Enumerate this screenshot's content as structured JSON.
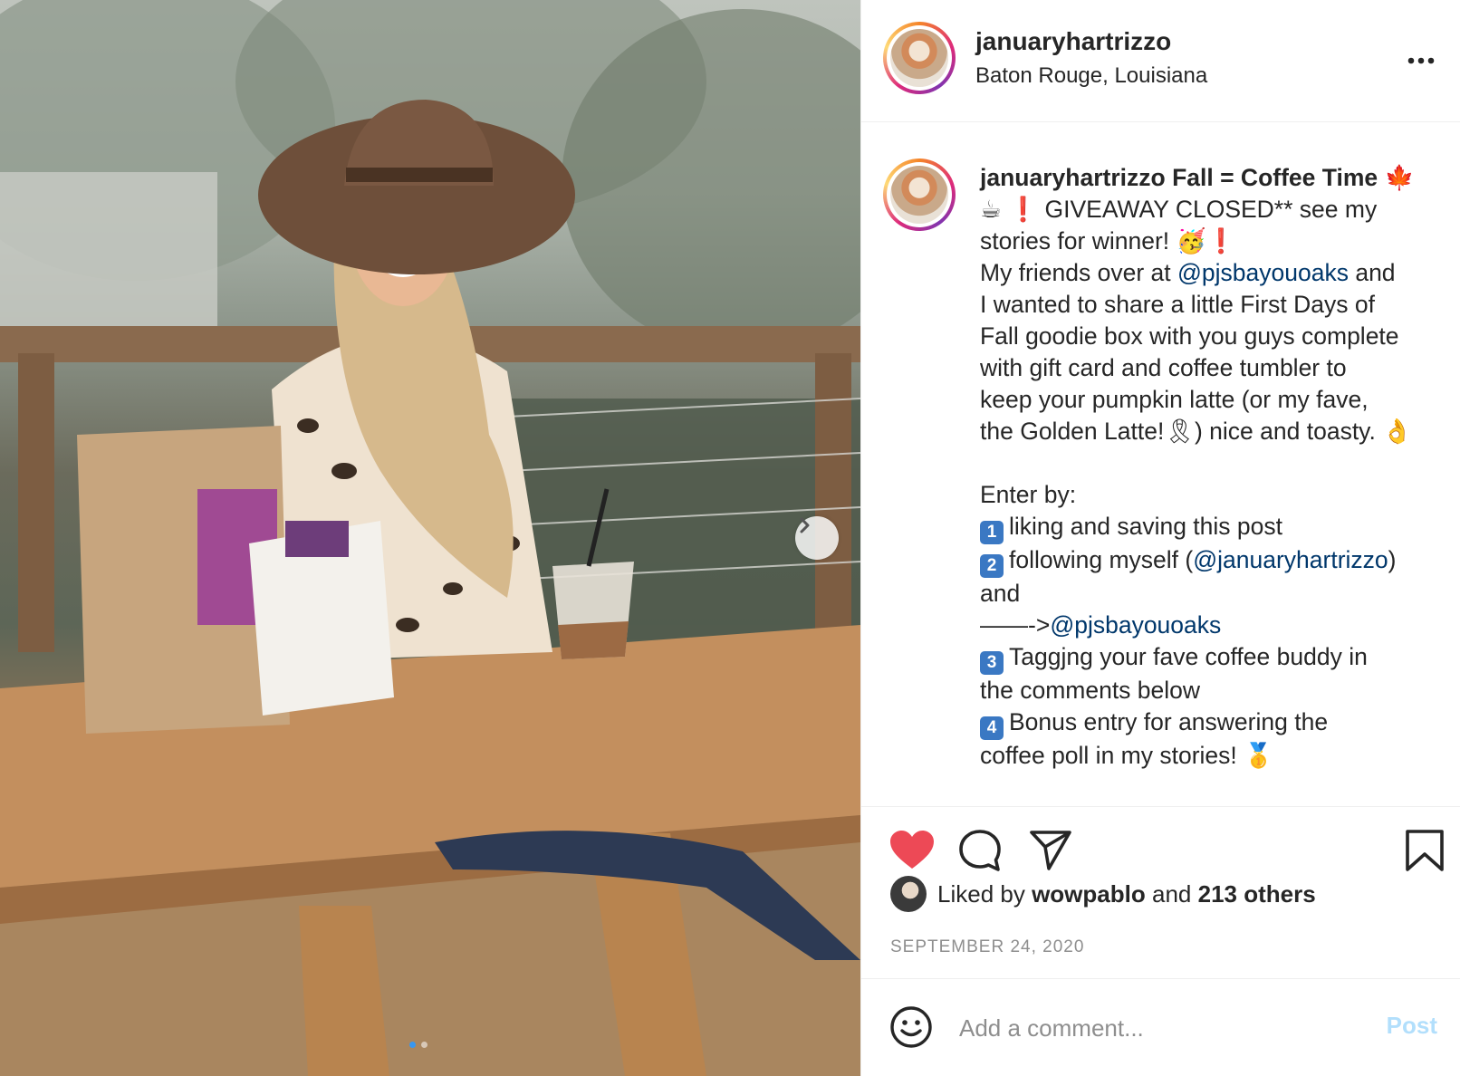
{
  "post": {
    "username": "januaryhartrizzo",
    "location": "Baton Rouge, Louisiana",
    "more_label": "•••"
  },
  "caption": {
    "username": "januaryhartrizzo",
    "title_text": "Fall = Coffee Time",
    "leaf_emoji": "🍁",
    "coffee_emoji": "☕",
    "exclaim": "❗",
    "giveaway_text": "GIVEAWAY CLOSED** see my",
    "stories_text": "stories for winner!",
    "party_emoji": "🥳",
    "l4_a": "My friends over at",
    "mention_pjs": "@pjsbayouoaks",
    "l4_b": "and",
    "l5": "I wanted to share a little First Days of",
    "l6": "Fall goodie box with you guys complete",
    "l7": "with gift card and coffee tumbler to",
    "l8": "keep your pumpkin latte (or my fave,",
    "l9_a": "the Golden Latte!",
    "ribbon_emoji": "🎗",
    "l9_b": ") nice and toasty.",
    "ok_emoji": "👌",
    "enter_by": "Enter by:",
    "step1_num": "1",
    "step1": "liking and saving this post",
    "step2_num": "2",
    "step2_a": "following myself (",
    "mention_self": "@januaryhartrizzo",
    "step2_b": ")",
    "and_text": "and",
    "arrow_text": "——->",
    "mention_pjs2": "@pjsbayouoaks",
    "step3_num": "3",
    "step3_a": "Taggjng your fave coffee buddy in",
    "step3_b": "the comments below",
    "step4_num": "4",
    "step4_a": "Bonus entry for answering the",
    "step4_b": "coffee poll in my stories!",
    "medal_emoji": "🥇"
  },
  "likes": {
    "prefix": "Liked by",
    "liker": "wowpablo",
    "middle": "and",
    "others": "213 others"
  },
  "date": "SEPTEMBER 24, 2020",
  "comment": {
    "placeholder": "Add a comment...",
    "post_label": "Post"
  },
  "icons": {
    "like": "heart-icon",
    "comment": "comment-icon",
    "share": "paper-plane-icon",
    "save": "bookmark-icon",
    "emoji": "smiley-icon",
    "next": "chevron-right-icon"
  },
  "colors": {
    "heart": "#ed4956",
    "mention": "#00376b",
    "post_disabled": "#b2dffc",
    "muted": "#8e8e8e"
  }
}
